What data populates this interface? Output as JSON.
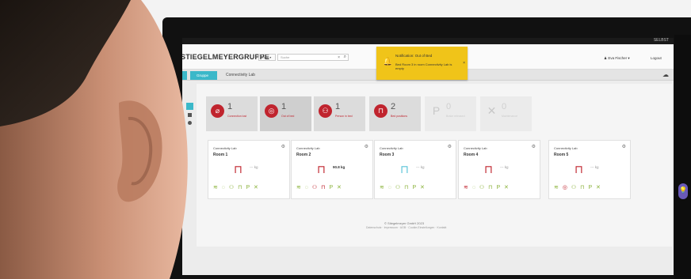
{
  "app": {
    "brand": "STIEGELMEYERGRUPPE",
    "group_label": "Group ▾",
    "search_placeholder": "Suche",
    "user_name": "Eva Fischer ▾",
    "logout_label": "Logout",
    "top_right": "SELBST"
  },
  "tabs": {
    "active": "Gruppe",
    "breadcrumb": "Connectivity Lab"
  },
  "notification": {
    "title": "Notification: Out of Bed",
    "message": "Bed Room 3 in room Connectivity Lab is empty",
    "close": "×"
  },
  "stats": [
    {
      "count": "1",
      "label": "Connection lost",
      "icon": "wifi-off-icon",
      "glyph": "⌀",
      "disabled": false
    },
    {
      "count": "1",
      "label": "Out of bed",
      "icon": "target-icon",
      "glyph": "◎",
      "disabled": false
    },
    {
      "count": "1",
      "label": "Person in bed",
      "icon": "person-icon",
      "glyph": "⚇",
      "disabled": false
    },
    {
      "count": "2",
      "label": "Bed positions",
      "icon": "bed-icon",
      "glyph": "⊓",
      "disabled": false
    },
    {
      "count": "0",
      "label": "Brake released",
      "icon": "parking-icon",
      "glyph": "P",
      "disabled": true
    },
    {
      "count": "0",
      "label": "Maintenance",
      "icon": "tools-icon",
      "glyph": "✕",
      "disabled": true
    }
  ],
  "rooms": [
    {
      "location": "Connectivity Lab",
      "name": "Room 1",
      "weight": "--- kg",
      "occupied": false
    },
    {
      "location": "Connectivity Lab",
      "name": "Room 2",
      "weight": "90.8 kg",
      "occupied": true
    },
    {
      "location": "Connectivity Lab",
      "name": "Room 3",
      "weight": "--- kg",
      "occupied": false
    },
    {
      "location": "Connectivity Lab",
      "name": "Room 4",
      "weight": "--- kg",
      "occupied": false
    },
    {
      "location": "Connectivity Lab",
      "name": "Room 5",
      "weight": "--- kg",
      "occupied": false
    }
  ],
  "footer": {
    "copyright": "© Stiegelmeyer GmbH 2023",
    "links": "Datenschutz · Impressum · AGB · Cookie-Einstellungen · Kontakt"
  },
  "colors": {
    "accent": "#3bb8c9",
    "alert": "#c0242e",
    "notification": "#f0c419",
    "ok": "#8ab23a"
  }
}
